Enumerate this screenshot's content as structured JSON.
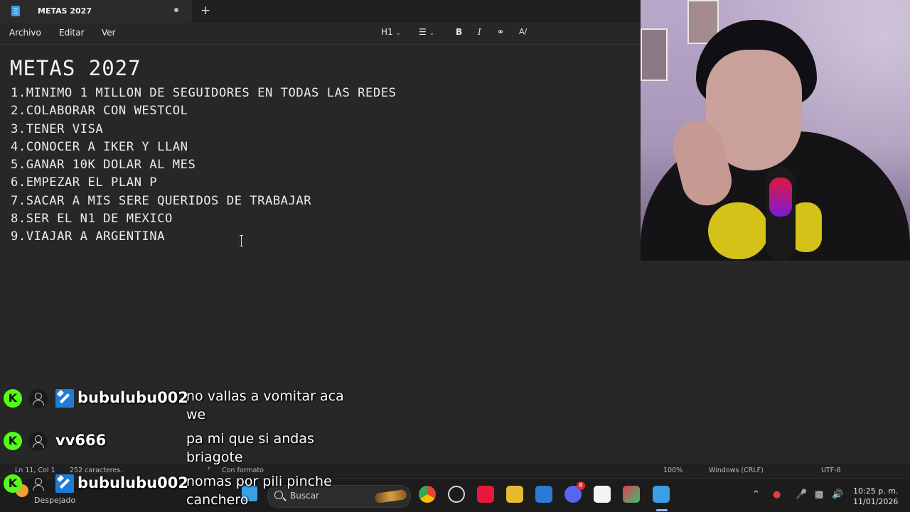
{
  "window": {
    "tab_title": "METAS 2027",
    "new_tab": "+"
  },
  "menu": {
    "file": "Archivo",
    "edit": "Editar",
    "view": "Ver"
  },
  "toolbar": {
    "heading": "H1",
    "bold": "B",
    "italic": "I"
  },
  "document": {
    "title": "METAS 2027",
    "lines": [
      "1.MINIMO 1 MILLON DE SEGUIDORES EN TODAS LAS REDES",
      "2.COLABORAR CON WESTCOL",
      "3.TENER VISA",
      "4.CONOCER A IKER Y LLAN",
      "5.GANAR 10K DOLAR AL MES",
      "6.EMPEZAR EL PLAN P",
      "7.SACAR A MIS SERE QUERIDOS DE TRABAJAR",
      "8.SER EL N1 DE MEXICO",
      "9.VIAJAR A ARGENTINA"
    ]
  },
  "status": {
    "position": "Ln 11, Col 1",
    "chars": "252 caracteres.",
    "format": "Con formato",
    "zoom": "100%",
    "line_endings": "Windows (CRLF)",
    "encoding": "UTF-8"
  },
  "chat": [
    {
      "user": "bubulubu002",
      "text": "no vallas a vomitar aca we",
      "moderator": true
    },
    {
      "user": "vv666",
      "text": "pa mi que si andas briagote",
      "moderator": false
    },
    {
      "user": "bubulubu002",
      "text": "nomas por pili pinche canchero",
      "moderator": true
    }
  ],
  "taskbar": {
    "weather": "Despejado",
    "search_placeholder": "Buscar",
    "discord_badge": "8",
    "time": "10:25 p. m.",
    "date": "11/01/2026"
  },
  "colors": {
    "accent": "#3aa0e6",
    "kick_green": "#53fc18",
    "mod_blue": "#1f7bd8"
  }
}
